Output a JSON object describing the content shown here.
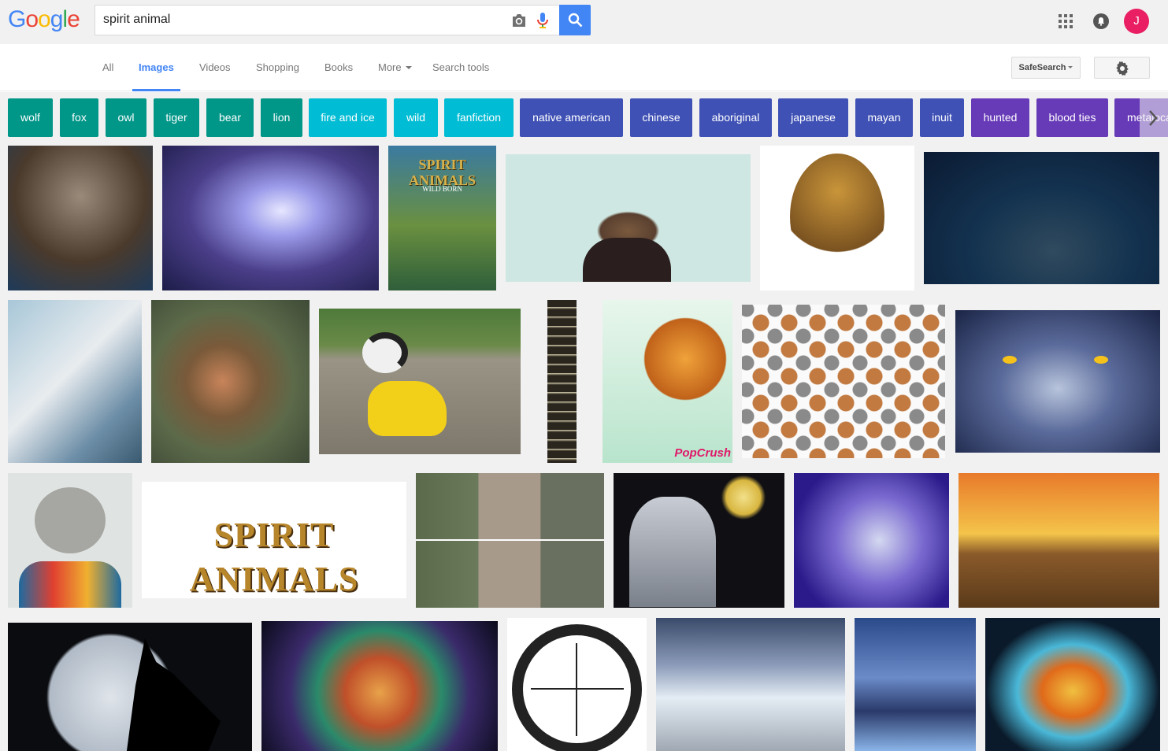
{
  "header": {
    "logo_letters": [
      "G",
      "o",
      "o",
      "g",
      "l",
      "e"
    ],
    "logo_colors": [
      "#4285f4",
      "#ea4335",
      "#fbbc05",
      "#4285f4",
      "#34a853",
      "#ea4335"
    ],
    "search_value": "spirit animal",
    "icons": [
      "camera-icon",
      "microphone-icon",
      "search-icon",
      "apps-grid-icon",
      "notifications-icon"
    ],
    "avatar_letter": "J",
    "avatar_color": "#e91e63"
  },
  "nav": {
    "tabs": [
      "All",
      "Images",
      "Videos",
      "Shopping",
      "Books",
      "More",
      "Search tools"
    ],
    "active_tab": "Images",
    "safesearch_label": "SafeSearch",
    "settings_icon": "gear-icon"
  },
  "chips": [
    {
      "label": "wolf",
      "color": "#009688"
    },
    {
      "label": "fox",
      "color": "#009688"
    },
    {
      "label": "owl",
      "color": "#009688"
    },
    {
      "label": "tiger",
      "color": "#009688"
    },
    {
      "label": "bear",
      "color": "#009688"
    },
    {
      "label": "lion",
      "color": "#009688"
    },
    {
      "label": "fire and ice",
      "color": "#00bcd4"
    },
    {
      "label": "wild",
      "color": "#00bcd4"
    },
    {
      "label": "fanfiction",
      "color": "#00bcd4"
    },
    {
      "label": "native american",
      "color": "#3f51b5"
    },
    {
      "label": "chinese",
      "color": "#3f51b5"
    },
    {
      "label": "aboriginal",
      "color": "#3f51b5"
    },
    {
      "label": "japanese",
      "color": "#3f51b5"
    },
    {
      "label": "mayan",
      "color": "#3f51b5"
    },
    {
      "label": "inuit",
      "color": "#3f51b5"
    },
    {
      "label": "hunted",
      "color": "#673ab7"
    },
    {
      "label": "blood ties",
      "color": "#673ab7"
    },
    {
      "label": "metalocalypse",
      "color": "#673ab7"
    }
  ],
  "images": {
    "spirit_animals_cover_title": "SPIRIT ANIMALS",
    "spirit_animals_cover_subtitle": "WILD BORN",
    "spirit_animals_logo": "SPIRIT ANIMALS",
    "popcrush_watermark": "PopCrush"
  }
}
